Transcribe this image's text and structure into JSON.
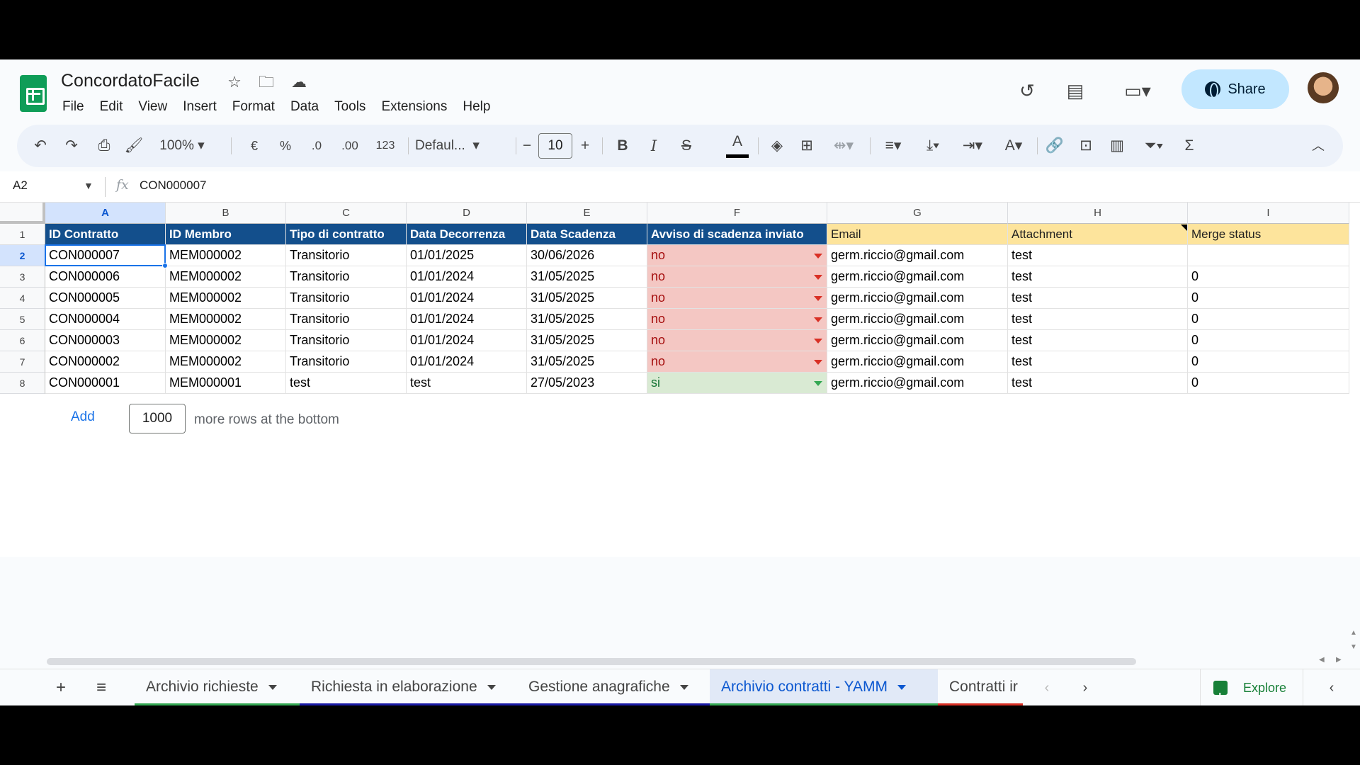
{
  "app": {
    "title": "ConcordatoFacile",
    "menu": [
      "File",
      "Edit",
      "View",
      "Insert",
      "Format",
      "Data",
      "Tools",
      "Extensions",
      "Help"
    ],
    "share_label": "Share"
  },
  "toolbar": {
    "zoom": "100%",
    "currency": "€",
    "percent": "%",
    "dec_decrease": ".0",
    "dec_increase": ".00",
    "number_format": "123",
    "font": "Defaul...",
    "font_size": "10",
    "minus": "−",
    "plus": "+",
    "bold": "B",
    "italic": "I",
    "strike": "S",
    "text_color": "A",
    "sum": "Σ"
  },
  "formula_bar": {
    "cell_ref": "A2",
    "fx": "fx",
    "value": "CON000007"
  },
  "grid": {
    "columns": [
      "A",
      "B",
      "C",
      "D",
      "E",
      "F",
      "G",
      "H",
      "I"
    ],
    "selected_column": "A",
    "selected_row": 2,
    "row_numbers": [
      "1",
      "2",
      "3",
      "4",
      "5",
      "6",
      "7",
      "8"
    ],
    "headers": [
      "ID Contratto",
      "ID Membro",
      "Tipo di contratto",
      "Data Decorrenza",
      "Data Scadenza",
      "Avviso di scadenza inviato",
      "Email",
      "Attachment",
      "Merge status"
    ],
    "rows": [
      [
        "CON000007",
        "MEM000002",
        "Transitorio",
        "01/01/2025",
        "30/06/2026",
        "no",
        "germ.riccio@gmail.com",
        "test",
        ""
      ],
      [
        "CON000006",
        "MEM000002",
        "Transitorio",
        "01/01/2024",
        "31/05/2025",
        "no",
        "germ.riccio@gmail.com",
        "test",
        "0"
      ],
      [
        "CON000005",
        "MEM000002",
        "Transitorio",
        "01/01/2024",
        "31/05/2025",
        "no",
        "germ.riccio@gmail.com",
        "test",
        "0"
      ],
      [
        "CON000004",
        "MEM000002",
        "Transitorio",
        "01/01/2024",
        "31/05/2025",
        "no",
        "germ.riccio@gmail.com",
        "test",
        "0"
      ],
      [
        "CON000003",
        "MEM000002",
        "Transitorio",
        "01/01/2024",
        "31/05/2025",
        "no",
        "germ.riccio@gmail.com",
        "test",
        "0"
      ],
      [
        "CON000002",
        "MEM000002",
        "Transitorio",
        "01/01/2024",
        "31/05/2025",
        "no",
        "germ.riccio@gmail.com",
        "test",
        "0"
      ],
      [
        "CON000001",
        "MEM000001",
        "test",
        "test",
        "27/05/2023",
        "si",
        "germ.riccio@gmail.com",
        "test",
        "0"
      ]
    ],
    "add_rows": {
      "link": "Add",
      "count": "1000",
      "text": "more rows at the bottom"
    }
  },
  "sheets": {
    "tabs": [
      {
        "label": "Archivio richieste",
        "color": "#34a853",
        "active": false
      },
      {
        "label": "Richiesta in elaborazione",
        "color": "#1a1aa6",
        "active": false
      },
      {
        "label": "Gestione anagrafiche",
        "color": "#1a1aa6",
        "active": false
      },
      {
        "label": "Archivio contratti - YAMM",
        "color": "#34a853",
        "active": true
      },
      {
        "label": "Contratti ir",
        "color": "#d93025",
        "active": false
      }
    ],
    "explore_label": "Explore"
  },
  "colors": {
    "header_blue": "#134f8c",
    "header_yellow": "#fde49c",
    "no_fill": "#f4c7c3",
    "si_fill": "#d9ead3",
    "accent": "#1a73e8"
  }
}
